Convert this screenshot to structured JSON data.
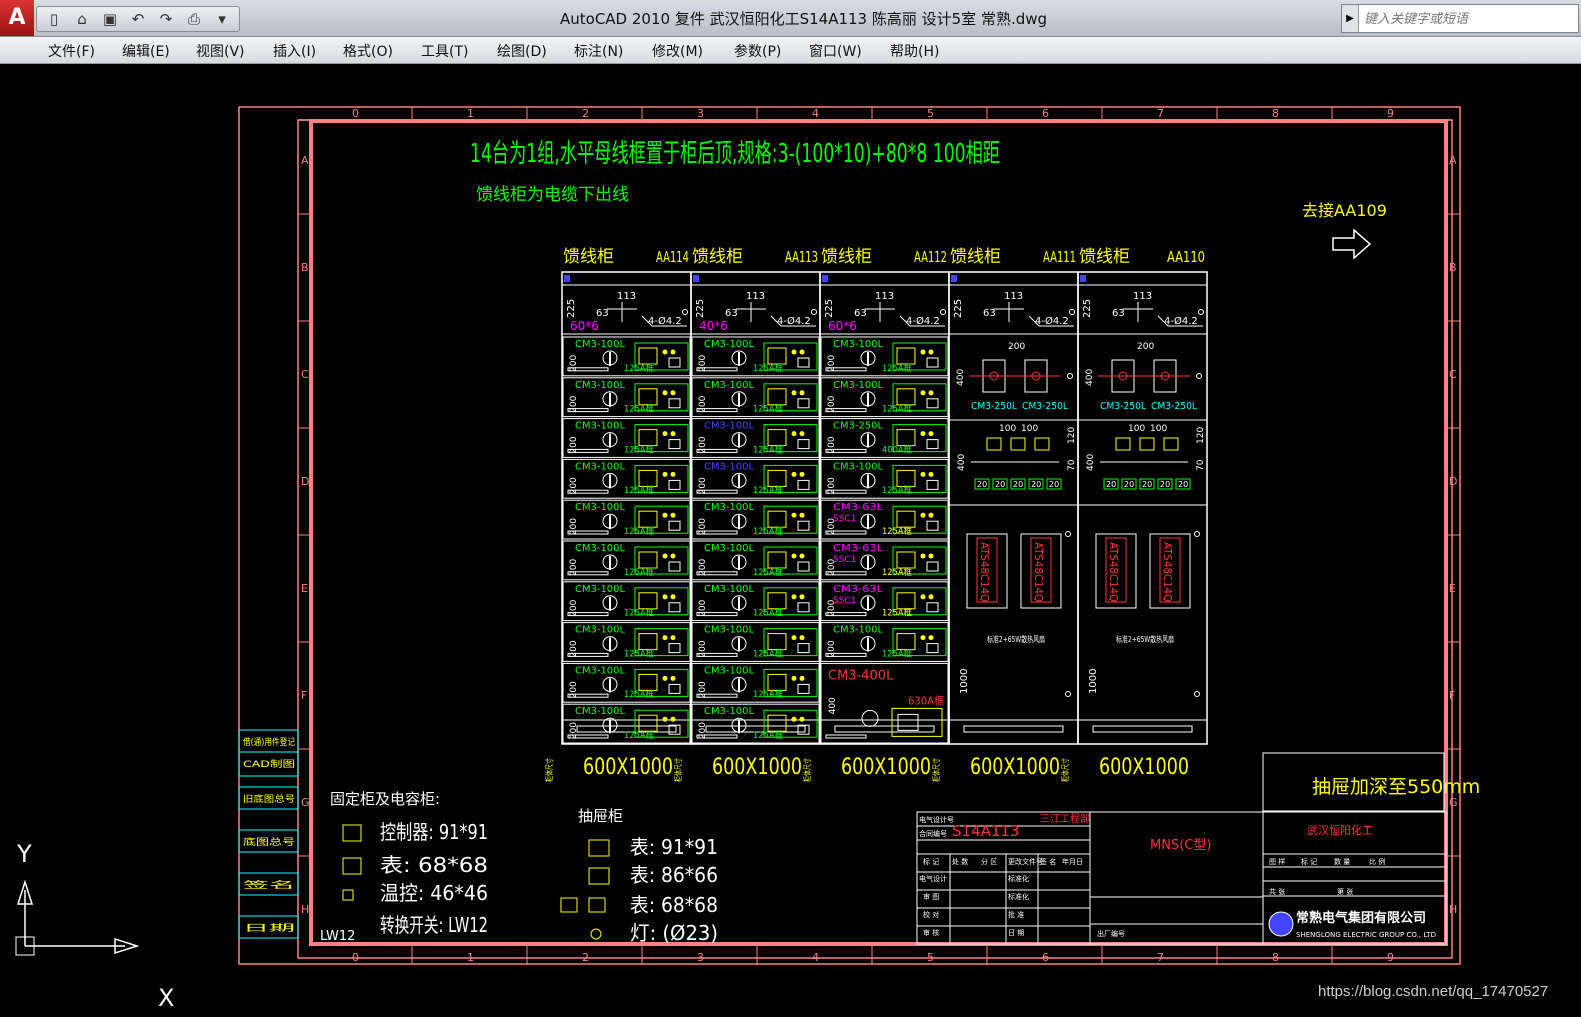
{
  "window": {
    "title": "AutoCAD 2010      复件 武汉恒阳化工S14A113 陈高丽 设计5室 常熟.dwg",
    "search_placeholder": "键入关键字或短语",
    "app_letter": "A"
  },
  "menu": [
    "文件(F)",
    "编辑(E)",
    "视图(V)",
    "插入(I)",
    "格式(O)",
    "工具(T)",
    "绘图(D)",
    "标注(N)",
    "修改(M)",
    "参数(P)",
    "窗口(W)",
    "帮助(H)"
  ],
  "drawing": {
    "col_numbers": [
      "0",
      "1",
      "2",
      "3",
      "4",
      "5",
      "6",
      "7",
      "8",
      "9"
    ],
    "row_letters": [
      "A",
      "B",
      "C",
      "D",
      "E",
      "F",
      "G",
      "H"
    ],
    "left_strip": [
      "借(通)用件登记",
      "CAD制图",
      "旧底图总号",
      "底图总号",
      "签名",
      "日期"
    ],
    "header_line1": "14台为1组,水平母线框置于柜后顶,规格:3-(100*10)+80*8    100相距",
    "header_line2": "馈线柜为电缆下出线",
    "jump_label": "去接AA109",
    "cabinets": [
      {
        "type": "馈线柜",
        "code": "AA114",
        "bus": "60*6"
      },
      {
        "type": "馈线柜",
        "code": "AA113",
        "bus": "40*6"
      },
      {
        "type": "馈线柜",
        "code": "AA112",
        "bus": "60*6"
      },
      {
        "type": "馈线柜",
        "code": "AA111",
        "bus": ""
      },
      {
        "type": "馈线柜",
        "code": "AA110",
        "bus": ""
      }
    ],
    "dim_labels": {
      "d225": "225",
      "d113": "113",
      "d63": "63",
      "hole": "4-Ø4.2",
      "d200": "200",
      "d400": "400",
      "d1000": "1000",
      "d100": "100",
      "d120": "120",
      "d70": "70",
      "d20": "20"
    },
    "breaker_100": "CM3-100L",
    "breaker_250": "CM3-250L",
    "breaker_63": "CM3-63L",
    "breaker_400": "CM3-400L",
    "rating_125": "125A框",
    "rating_400": "400A框",
    "rating_630": "630A框",
    "ssc": "SSC1",
    "ats": "ATS48C14Q",
    "fan_note": "标准2+65W散热风扇",
    "dim_footer": "600X1000",
    "footer_prefix": "柜体尺寸",
    "drawer_note": "抽屉加深至550mm",
    "legend_fixed_title": "固定柜及电容柜:",
    "legend_fixed": [
      "控制器: 91*91",
      "表: 68*68",
      "温控: 46*46",
      "转换开关: LW12"
    ],
    "legend_lw": "LW12",
    "legend_drawer_title": "抽屉柜",
    "legend_drawer": [
      "表: 91*91",
      "表: 86*66",
      "表: 68*68",
      "灯: (Ø23)"
    ],
    "title_block": {
      "project_code": "S14A113",
      "job": "三江工程部",
      "product": "MNS(C型)",
      "client": "武汉恒阳化工",
      "company": "常熟电气集团有限公司",
      "company_en": "SHENGLONG ELECTRIC GROUP CO., LTD",
      "labels": [
        "电气设计号",
        "合同编号",
        "标 记",
        "处 数",
        "分 区",
        "更改文件号",
        "签 名",
        "年月日",
        "电气设计",
        "标准化",
        "审 图",
        "标准化",
        "校 对",
        "批 准",
        "审 核",
        "日 期",
        "出厂编号",
        "图 样",
        "标 记",
        "数 量",
        "比 例",
        "共 张",
        "第 张"
      ],
      "axis_y": "Y",
      "axis_x": "X"
    }
  },
  "watermark": "https://blog.csdn.net/qq_17470527",
  "colors": {
    "frame": "#ff8080",
    "green": "#00ff00",
    "yellow": "#ffff00",
    "white": "#ffffff",
    "red": "#ff3333",
    "magenta": "#ff00ff",
    "blue": "#4444ff",
    "cyan": "#00ffff"
  }
}
